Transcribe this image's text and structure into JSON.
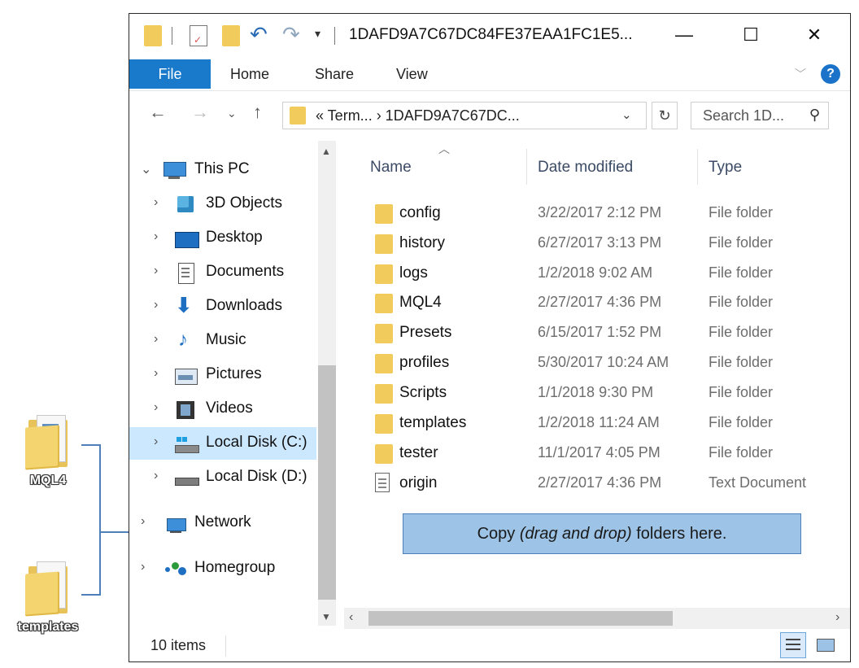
{
  "desktop": {
    "folders": [
      {
        "label": "MQL4"
      },
      {
        "label": "templates"
      }
    ]
  },
  "window": {
    "title": "1DAFD9A7C67DC84FE37EAA1FC1E5...",
    "minimize": "—",
    "maximize": "☐",
    "close": "✕"
  },
  "ribbon": {
    "file": "File",
    "home": "Home",
    "share": "Share",
    "view": "View",
    "help": "?"
  },
  "address": {
    "path": "« Term... › 1DAFD9A7C67DC...",
    "search_placeholder": "Search 1D..."
  },
  "nav": {
    "items": [
      {
        "label": "This PC"
      },
      {
        "label": "3D Objects"
      },
      {
        "label": "Desktop"
      },
      {
        "label": "Documents"
      },
      {
        "label": "Downloads"
      },
      {
        "label": "Music"
      },
      {
        "label": "Pictures"
      },
      {
        "label": "Videos"
      },
      {
        "label": "Local Disk (C:)"
      },
      {
        "label": "Local Disk (D:)"
      },
      {
        "label": "Network"
      },
      {
        "label": "Homegroup"
      }
    ]
  },
  "columns": {
    "name": "Name",
    "date": "Date modified",
    "type": "Type"
  },
  "files": [
    {
      "name": "config",
      "date": "3/22/2017 2:12 PM",
      "type": "File folder"
    },
    {
      "name": "history",
      "date": "6/27/2017 3:13 PM",
      "type": "File folder"
    },
    {
      "name": "logs",
      "date": "1/2/2018 9:02 AM",
      "type": "File folder"
    },
    {
      "name": "MQL4",
      "date": "2/27/2017 4:36 PM",
      "type": "File folder"
    },
    {
      "name": "Presets",
      "date": "6/15/2017 1:52 PM",
      "type": "File folder"
    },
    {
      "name": "profiles",
      "date": "5/30/2017 10:24 AM",
      "type": "File folder"
    },
    {
      "name": "Scripts",
      "date": "1/1/2018 9:30 PM",
      "type": "File folder"
    },
    {
      "name": "templates",
      "date": "1/2/2018 11:24 AM",
      "type": "File folder"
    },
    {
      "name": "tester",
      "date": "11/1/2017 4:05 PM",
      "type": "File folder"
    },
    {
      "name": "origin",
      "date": "2/27/2017 4:36 PM",
      "type": "Text Document"
    }
  ],
  "callout": {
    "prefix": "Copy ",
    "emphasis": "(drag and drop)",
    "suffix": " folders here."
  },
  "status": {
    "count": "10 items"
  },
  "colors": {
    "accent": "#1979ca",
    "selection": "#cce8ff",
    "callout": "#9dc3e6",
    "folder": "#f1cb5b"
  }
}
